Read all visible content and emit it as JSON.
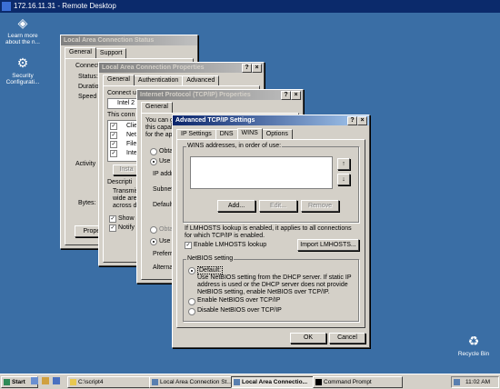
{
  "remote_desktop": {
    "title": "172.16.11.31 - Remote Desktop"
  },
  "desktop_icons": [
    {
      "label": "Learn more about the n..."
    },
    {
      "label": "Security Configurati..."
    },
    {
      "label": "Recycle Bin"
    }
  ],
  "win1": {
    "title": "Local Area Connection Status",
    "tabs": [
      "General",
      "Support"
    ],
    "frag": {
      "connect": "Connect",
      "status": "Status:",
      "duration": "Duratio",
      "speed": "Speed",
      "activity": "Activity",
      "bytes": "Bytes:",
      "properties": "Propert"
    }
  },
  "win2": {
    "title": "Local Area Connection Properties",
    "tabs": [
      "General",
      "Authentication",
      "Advanced"
    ],
    "frag": {
      "connect_using": "Connect us",
      "adapter": "Intel 2",
      "this_conn": "This conn",
      "item1": "Clie",
      "item2": "Net",
      "item3": "File",
      "item4": "Inte",
      "install": "Insta",
      "description": "Descripti",
      "desc1": "Transmis",
      "desc2": "wide area",
      "desc3": "across div",
      "show_icon": "Show ic",
      "notify": "Notify m"
    }
  },
  "win3": {
    "title": "Internet Protocol (TCP/IP) Properties",
    "tabs": [
      "General"
    ],
    "frag": {
      "line1": "You can ge",
      "line2": "this capabi",
      "line3": "for the app",
      "obtain": "Obtai",
      "use_following": "Use th",
      "ip": "IP addre",
      "subnet": "Subnet m",
      "gateway": "Default g",
      "obtain_dns": "Obtai",
      "use_dns": "Use th",
      "preferred": "Preferred",
      "alternate": "Alternat"
    }
  },
  "adv": {
    "title": "Advanced TCP/IP Settings",
    "tabs": [
      "IP Settings",
      "DNS",
      "WINS",
      "Options"
    ],
    "wins_label": "WINS addresses, in order of use:",
    "add": "Add...",
    "edit": "Edit...",
    "remove": "Remove",
    "lmhosts_info": "If LMHOSTS lookup is enabled, it applies to all connections for which TCP/IP is enabled.",
    "enable_lmhosts": "Enable LMHOSTS lookup",
    "import_lmhosts": "Import LMHOSTS...",
    "netbios_title": "NetBIOS setting",
    "default": "Default:",
    "default_desc": "Use NetBIOS setting from the DHCP server. If static IP address is used or the DHCP server does not provide NetBIOS setting, enable NetBIOS over TCP/IP.",
    "enable_netbios": "Enable NetBIOS over TCP/IP",
    "disable_netbios": "Disable NetBIOS over TCP/IP",
    "ok": "OK",
    "cancel": "Cancel"
  },
  "taskbar": {
    "start": "Start",
    "items": [
      "C:\\script4",
      "Local Area Connection St...",
      "Local Area Connectio...",
      "Command Prompt"
    ],
    "time": "11:02 AM"
  }
}
